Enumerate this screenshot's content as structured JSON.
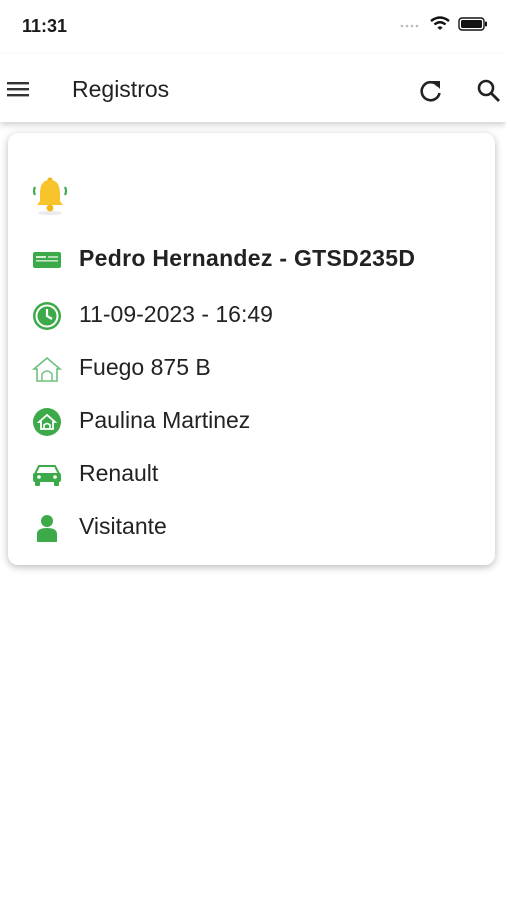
{
  "status": {
    "time": "11:31"
  },
  "appbar": {
    "title": "Registros"
  },
  "card": {
    "rows": [
      {
        "icon": "id-card-icon",
        "text": "Pedro Hernandez - GTSD235D"
      },
      {
        "icon": "clock-icon",
        "text": "11-09-2023 - 16:49"
      },
      {
        "icon": "house-outline-icon",
        "text": "Fuego 875 B"
      },
      {
        "icon": "home-circle-icon",
        "text": "Paulina Martinez"
      },
      {
        "icon": "car-icon",
        "text": "Renault"
      },
      {
        "icon": "person-icon",
        "text": "Visitante"
      }
    ]
  },
  "colors": {
    "accent": "#3daa4a",
    "bell": "#f7c52b"
  }
}
